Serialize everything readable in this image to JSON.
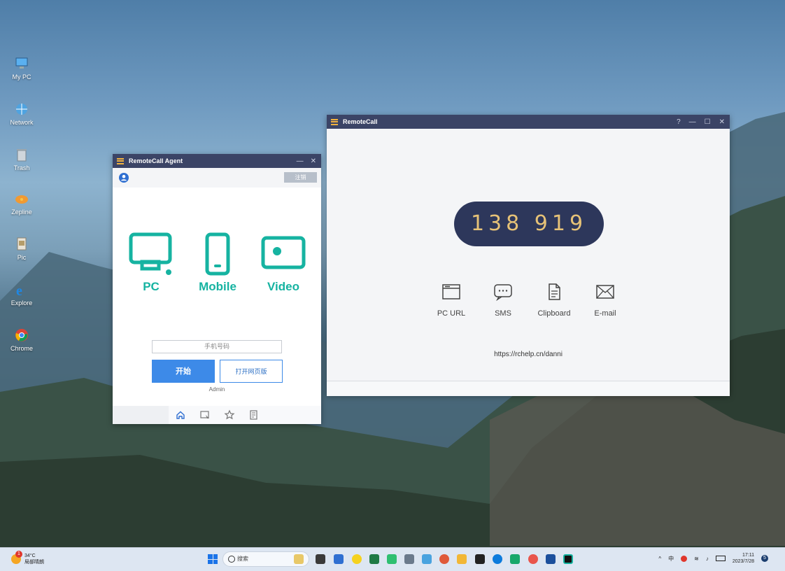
{
  "desktop": {
    "icons": [
      {
        "label": "My PC",
        "icon": "computer-icon"
      },
      {
        "label": "Network",
        "icon": "network-icon"
      },
      {
        "label": "Trash",
        "icon": "trash-icon"
      },
      {
        "label": "Zepline",
        "icon": "zeplin-icon"
      },
      {
        "label": "Pic",
        "icon": "picture-icon"
      },
      {
        "label": "Explore",
        "icon": "internet-explorer-icon"
      },
      {
        "label": "Chrome",
        "icon": "chrome-icon"
      }
    ]
  },
  "agent": {
    "title": "RemoteCall Agent",
    "minimize": "—",
    "close": "✕",
    "logout_label": "注销",
    "types": [
      {
        "label": "PC",
        "icon": "monitor-icon"
      },
      {
        "label": "Mobile",
        "icon": "phone-icon"
      },
      {
        "label": "Video",
        "icon": "video-icon"
      }
    ],
    "phone_placeholder": "手机号码",
    "start_label": "开始",
    "open_web_label": "打开网页版",
    "admin_label": "Admin",
    "accent": "#16b3a1",
    "button_color": "#3d8ae8"
  },
  "remotecall": {
    "title": "RemoteCall",
    "help": "?",
    "minimize": "—",
    "maximize": "☐",
    "close": "✕",
    "code": "138 919",
    "share_options": [
      {
        "label": "PC URL",
        "icon": "browser-window-icon"
      },
      {
        "label": "SMS",
        "icon": "chat-bubble-icon"
      },
      {
        "label": "Clipboard",
        "icon": "clipboard-document-icon"
      },
      {
        "label": "E-mail",
        "icon": "envelope-icon"
      }
    ],
    "url": "https://rchelp.cn/danni",
    "code_pill_color": "#2d375b",
    "code_text_color": "#e6c277"
  },
  "taskbar": {
    "weather_temp": "34°C",
    "weather_desc": "局部晴朗",
    "weather_badge": "1",
    "search_placeholder": "搜索",
    "time": "17:11",
    "date": "2023/7/28",
    "notification_count": "5",
    "tray_ime": "中",
    "tray_chevron": "^"
  }
}
